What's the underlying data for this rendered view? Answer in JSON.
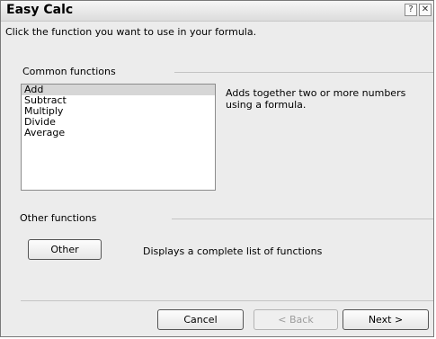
{
  "window": {
    "title": "Easy Calc",
    "help_glyph": "?",
    "close_glyph": "✕"
  },
  "instruction": "Click the function you want to use in your formula.",
  "common": {
    "label": "Common functions",
    "items": [
      "Add",
      "Subtract",
      "Multiply",
      "Divide",
      "Average"
    ],
    "selected_index": 0,
    "description": "Adds together two or more numbers using a formula."
  },
  "other": {
    "label": "Other functions",
    "button_label": "Other",
    "description": "Displays a complete list of functions"
  },
  "footer": {
    "cancel": "Cancel",
    "back": "< Back",
    "next": "Next >"
  }
}
